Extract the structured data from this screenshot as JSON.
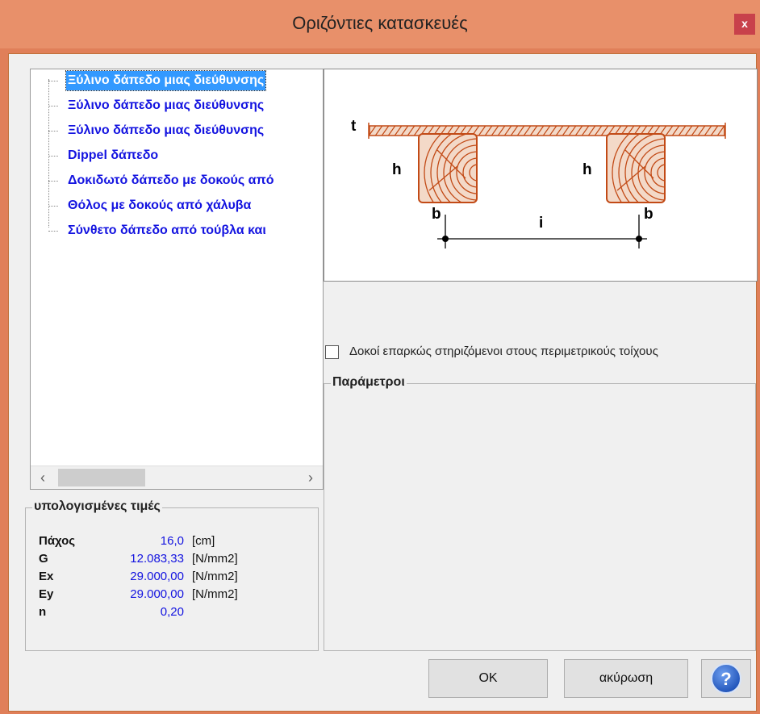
{
  "window": {
    "title": "Οριζόντιες κατασκευές",
    "close_label": "x"
  },
  "tree": {
    "items": [
      {
        "label": "Ξύλινο δάπεδο μιας διεύθυνσης",
        "selected": true
      },
      {
        "label": "Ξύλινο δάπεδο μιας διεύθυνσης",
        "selected": false
      },
      {
        "label": "Ξύλινο δάπεδο μιας διεύθυνσης",
        "selected": false
      },
      {
        "label": "Dippel δάπεδο",
        "selected": false
      },
      {
        "label": "Δοκιδωτό δάπεδο με δοκούς από",
        "selected": false
      },
      {
        "label": "Θόλος με δοκούς από χάλυβα",
        "selected": false
      },
      {
        "label": "Σύνθετο δάπεδο από τούβλα και",
        "selected": false
      }
    ],
    "scroll_left_icon": "‹",
    "scroll_right_icon": "›"
  },
  "diagram": {
    "labels": {
      "t": "t",
      "h_left": "h",
      "h_right": "h",
      "b_left": "b",
      "b_right": "b",
      "i": "i"
    },
    "colors": {
      "wood": "#c24a16",
      "wood_fill": "#f3d9c8",
      "dimension": "#000000"
    }
  },
  "option": {
    "label": "Δοκοί επαρκώς στηριζόμενοι στους περιμετρικούς τοίχους",
    "checked": false
  },
  "parameters": {
    "legend": "Παράμετροι"
  },
  "calculated": {
    "legend": "υπολογισμένες τιμές",
    "rows": [
      {
        "name": "Πάχος",
        "value": "16,0",
        "unit": "[cm]"
      },
      {
        "name": "G",
        "value": "12.083,33",
        "unit": "[N/mm2]"
      },
      {
        "name": "Ex",
        "value": "29.000,00",
        "unit": "[N/mm2]"
      },
      {
        "name": "Ey",
        "value": "29.000,00",
        "unit": "[N/mm2]"
      },
      {
        "name": "n",
        "value": "0,20",
        "unit": ""
      }
    ]
  },
  "buttons": {
    "ok": "OK",
    "cancel": "ακύρωση",
    "help_icon": "?"
  },
  "colors": {
    "title_bar": "#e8906a",
    "selection": "#3399ff",
    "tree_text": "#1313e0",
    "value_text": "#1313e0",
    "close_button": "#c8414b"
  }
}
